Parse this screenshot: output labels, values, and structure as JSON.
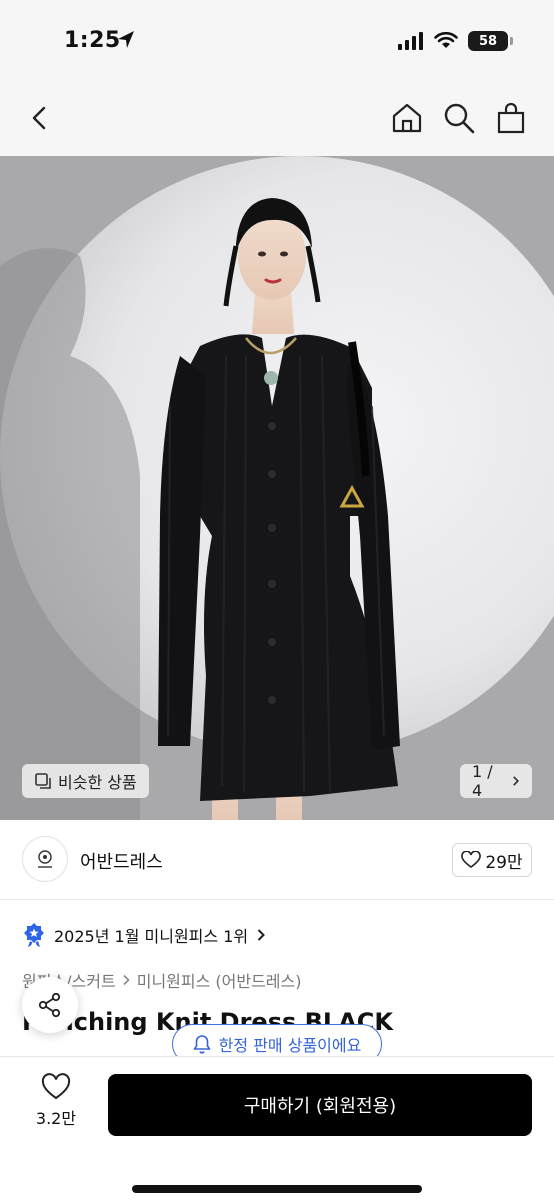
{
  "status_bar": {
    "time": "1:25",
    "battery": "58"
  },
  "nav": {
    "icons": [
      "back-icon",
      "home-icon",
      "search-icon",
      "shopping-bag-icon"
    ]
  },
  "gallery": {
    "similar_label": "비슷한 상품",
    "counter": "1 / 4"
  },
  "brand": {
    "name": "어반드레스",
    "likes": "29만"
  },
  "ranking": {
    "text": "2025년 1월 미니원피스 1위"
  },
  "breadcrumb": {
    "category": "원피스/스커트",
    "subcategory": "미니원피스 (어반드레스)"
  },
  "product": {
    "title": "Punching Knit Dress BLACK"
  },
  "limited": {
    "text": "한정 판매 상품이에요"
  },
  "bottom": {
    "wish_count": "3.2만",
    "buy_label": "구매하기 (회원전용)"
  },
  "colors": {
    "accent_blue": "#3563d8",
    "buy_bg": "#000000"
  }
}
